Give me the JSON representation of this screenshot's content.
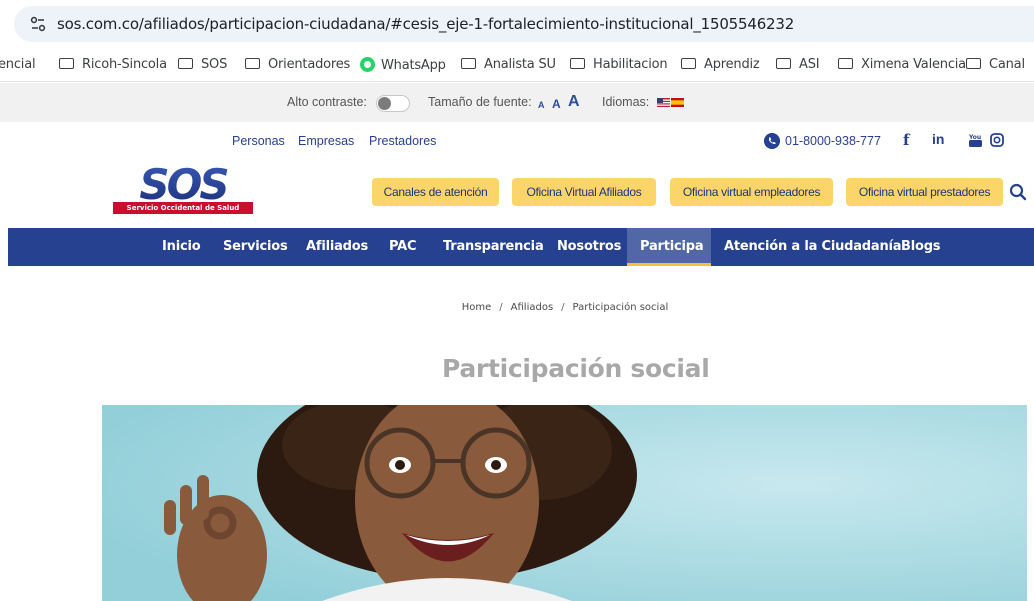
{
  "browser": {
    "url": "sos.com.co/afiliados/participacion-ciudadana/#cesis_eje-1-fortalecimiento-institucional_1505546232",
    "bookmarks": [
      {
        "label": "encial",
        "type": "text"
      },
      {
        "label": "Ricoh-Sincola",
        "type": "folder"
      },
      {
        "label": "SOS",
        "type": "folder"
      },
      {
        "label": "Orientadores",
        "type": "folder"
      },
      {
        "label": "WhatsApp",
        "type": "whatsapp"
      },
      {
        "label": "Analista SU",
        "type": "folder"
      },
      {
        "label": "Habilitacion",
        "type": "folder"
      },
      {
        "label": "Aprendiz",
        "type": "folder"
      },
      {
        "label": "ASI",
        "type": "folder"
      },
      {
        "label": "Ximena Valencia",
        "type": "folder"
      },
      {
        "label": "Canal",
        "type": "folder"
      }
    ]
  },
  "accessibility": {
    "contrast_label": "Alto contraste:",
    "contrast_on": false,
    "font_size_label": "Tamaño de fuente:",
    "font_sizes": [
      "A",
      "A",
      "A"
    ],
    "languages_label": "Idiomas:"
  },
  "top_links": {
    "items": [
      "Personas",
      "Empresas",
      "Prestadores"
    ],
    "phone": "01-8000-938-777",
    "social": [
      "f",
      "in",
      "You",
      "ig"
    ]
  },
  "header": {
    "logo_text": "SOS",
    "logo_tagline": "Servicio Occidental de Salud",
    "buttons": [
      "Canales de atención",
      "Oficina Virtual Afiliados",
      "Oficina virtual empleadores",
      "Oficina virtual prestadores"
    ]
  },
  "nav": {
    "items": [
      "Inicio",
      "Servicios",
      "Afiliados",
      "PAC",
      "Transparencia",
      "Nosotros",
      "Participa",
      "Atención a la Ciudadanía",
      "Blogs"
    ],
    "active": "Participa"
  },
  "breadcrumb": [
    "Home",
    "Afiliados",
    "Participación social"
  ],
  "page_title": "Participación social",
  "colors": {
    "brand_blue": "#25418f",
    "accent_yellow": "#fcd56a",
    "brand_red": "#c8102e",
    "hero_bg": "#a9dbe3"
  }
}
